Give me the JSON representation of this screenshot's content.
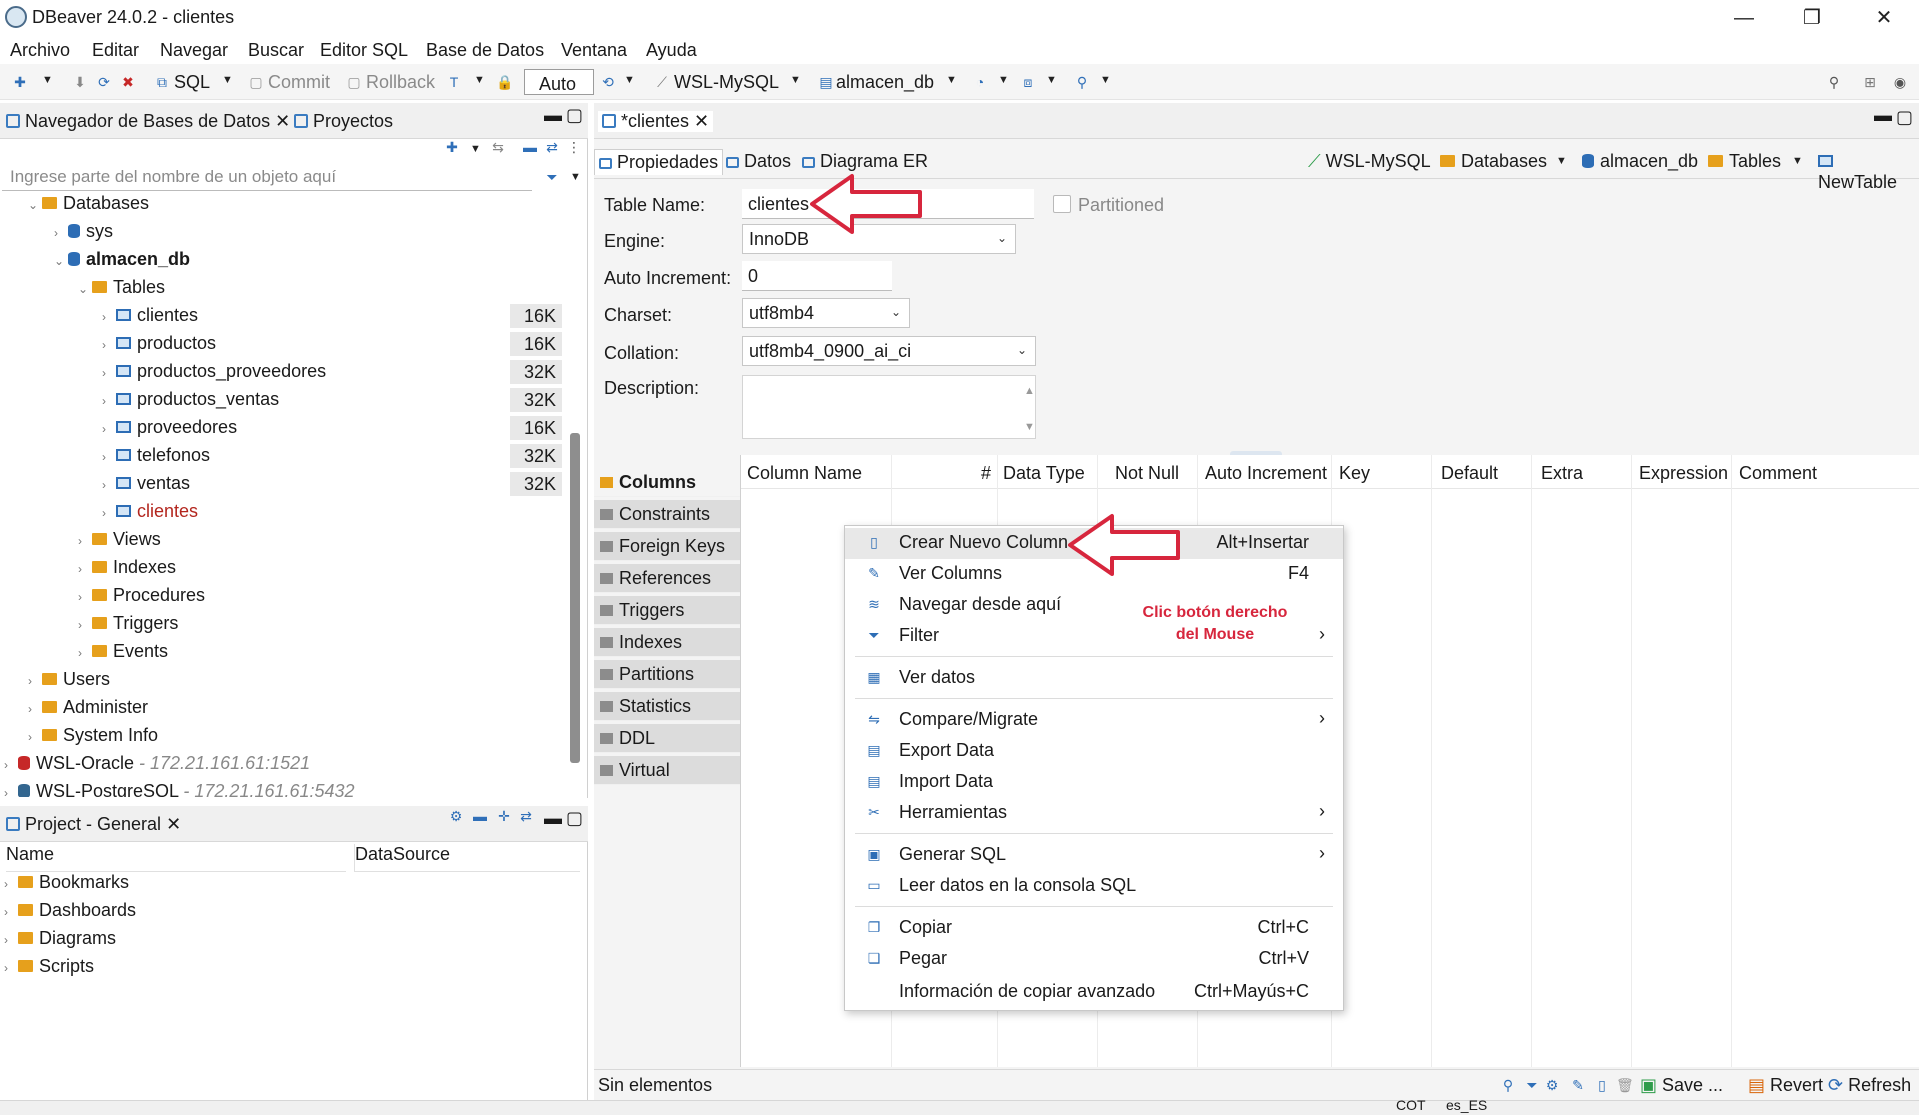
{
  "window": {
    "title": "DBeaver 24.0.2 - clientes",
    "minimize": "—",
    "maximize": "❐",
    "close": "✕"
  },
  "menu": [
    "Archivo",
    "Editar",
    "Navegar",
    "Buscar",
    "Editor SQL",
    "Base de Datos",
    "Ventana",
    "Ayuda"
  ],
  "toolbar": {
    "sql": "SQL",
    "commit": "Commit",
    "rollback": "Rollback",
    "auto": "Auto",
    "connection": "WSL-MySQL",
    "database": "almacen_db"
  },
  "navigator": {
    "tab_label": "Navegador de Bases de Datos",
    "tab_projects": "Proyectos",
    "filter_placeholder": "Ingrese parte del nombre de un objeto aquí",
    "tree": [
      {
        "label": "Databases",
        "icon": "folder-icon",
        "bold": false
      },
      {
        "label": "sys",
        "icon": "database-icon"
      },
      {
        "label": "almacen_db",
        "icon": "database-icon",
        "bold": true
      },
      {
        "label": "Tables",
        "icon": "folder-icon"
      },
      {
        "label": "clientes",
        "icon": "table-icon",
        "size": "16K"
      },
      {
        "label": "productos",
        "icon": "table-icon",
        "size": "16K"
      },
      {
        "label": "productos_proveedores",
        "icon": "table-icon",
        "size": "32K"
      },
      {
        "label": "productos_ventas",
        "icon": "table-icon",
        "size": "32K"
      },
      {
        "label": "proveedores",
        "icon": "table-icon",
        "size": "16K"
      },
      {
        "label": "telefonos",
        "icon": "table-icon",
        "size": "32K"
      },
      {
        "label": "ventas",
        "icon": "table-icon",
        "size": "32K"
      },
      {
        "label": "clientes",
        "icon": "table-icon",
        "new": true
      },
      {
        "label": "Views",
        "icon": "folder-icon"
      },
      {
        "label": "Indexes",
        "icon": "folder-icon"
      },
      {
        "label": "Procedures",
        "icon": "folder-icon"
      },
      {
        "label": "Triggers",
        "icon": "folder-icon"
      },
      {
        "label": "Events",
        "icon": "folder-icon"
      },
      {
        "label": "Users",
        "icon": "folder-icon"
      },
      {
        "label": "Administer",
        "icon": "folder-icon"
      },
      {
        "label": "System Info",
        "icon": "folder-icon"
      },
      {
        "label": "WSL-Oracle",
        "icon": "oracle-icon",
        "host": "- 172.21.161.61:1521"
      },
      {
        "label": "WSL-PostgreSQL",
        "icon": "postgres-icon",
        "host": "- 172.21.161.61:5432"
      }
    ]
  },
  "project": {
    "tab_label": "Project - General",
    "col_name": "Name",
    "col_datasource": "DataSource",
    "items": [
      "Bookmarks",
      "Dashboards",
      "Diagrams",
      "Scripts"
    ]
  },
  "editor": {
    "tab_label": "*clientes",
    "subtabs": [
      "Propiedades",
      "Datos",
      "Diagrama ER"
    ],
    "breadcrumb": [
      "WSL-MySQL",
      "Databases",
      "almacen_db",
      "Tables",
      "NewTable"
    ],
    "form": {
      "table_name_label": "Table Name:",
      "table_name_value": "clientes",
      "partitioned_label": "Partitioned",
      "engine_label": "Engine:",
      "engine_value": "InnoDB",
      "auto_increment_label": "Auto Increment:",
      "auto_increment_value": "0",
      "charset_label": "Charset:",
      "charset_value": "utf8mb4",
      "collation_label": "Collation:",
      "collation_value": "utf8mb4_0900_ai_ci",
      "description_label": "Description:"
    },
    "categories": [
      "Columns",
      "Constraints",
      "Foreign Keys",
      "References",
      "Triggers",
      "Indexes",
      "Partitions",
      "Statistics",
      "DDL",
      "Virtual"
    ],
    "grid_columns": [
      "Column Name",
      "#",
      "Data Type",
      "Not Null",
      "Auto Increment",
      "Key",
      "Default",
      "Extra",
      "Expression",
      "Comment"
    ],
    "status_text": "Sin elementos",
    "status_actions": {
      "save": "Save ...",
      "revert": "Revert",
      "refresh": "Refresh"
    }
  },
  "context_menu": {
    "items": [
      {
        "label": "Crear Nuevo Column",
        "shortcut": "Alt+Insertar",
        "icon": "new-column-icon",
        "highlighted": true
      },
      {
        "label": "Ver Columns",
        "shortcut": "F4",
        "icon": "edit-icon"
      },
      {
        "label": "Navegar desde aquí",
        "shortcut": "",
        "icon": "navigate-icon"
      },
      {
        "label": "Filter",
        "shortcut": "",
        "icon": "filter-icon",
        "submenu": true
      },
      {
        "label": "Ver datos",
        "shortcut": "",
        "icon": "data-icon",
        "sep_before": true
      },
      {
        "label": "Compare/Migrate",
        "shortcut": "",
        "icon": "compare-icon",
        "submenu": true,
        "sep_before": true
      },
      {
        "label": "Export Data",
        "shortcut": "",
        "icon": "export-icon"
      },
      {
        "label": "Import Data",
        "shortcut": "",
        "icon": "import-icon"
      },
      {
        "label": "Herramientas",
        "shortcut": "",
        "icon": "tools-icon",
        "submenu": true
      },
      {
        "label": "Generar SQL",
        "shortcut": "",
        "icon": "sql-icon",
        "submenu": true,
        "sep_before": true
      },
      {
        "label": "Leer datos en la consola SQL",
        "shortcut": "",
        "icon": "console-icon"
      },
      {
        "label": "Copiar",
        "shortcut": "Ctrl+C",
        "icon": "copy-icon",
        "sep_before": true
      },
      {
        "label": "Pegar",
        "shortcut": "Ctrl+V",
        "icon": "paste-icon"
      },
      {
        "label": "Información de copiar avanzado",
        "shortcut": "Ctrl+Mayús+C",
        "icon": ""
      }
    ]
  },
  "annotation": {
    "line1": "Clic botón derecho",
    "line2": "del Mouse",
    "color": "#d7263d"
  },
  "bottom": {
    "enc": "COT",
    "locale": "es_ES"
  }
}
